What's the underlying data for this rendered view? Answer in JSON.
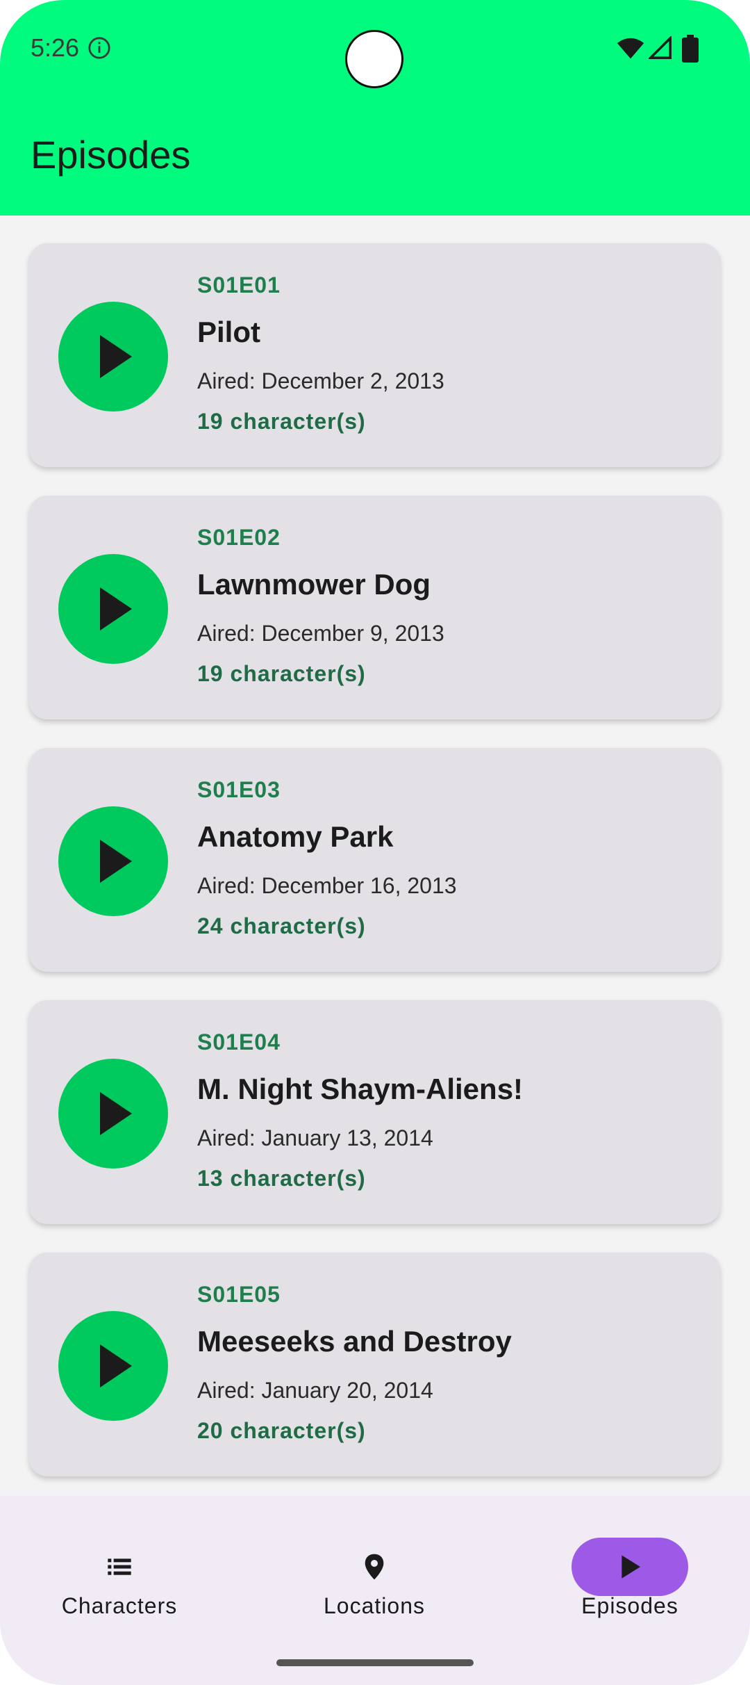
{
  "status_bar": {
    "time": "5:26",
    "icons": [
      "info-icon",
      "wifi-icon",
      "signal-icon",
      "battery-icon"
    ]
  },
  "header": {
    "title": "Episodes",
    "color": "#00fb7f"
  },
  "episodes": [
    {
      "code": "S01E01",
      "title": "Pilot",
      "aired": "Aired: December 2, 2013",
      "characters": "19 character(s)"
    },
    {
      "code": "S01E02",
      "title": "Lawnmower Dog",
      "aired": "Aired: December 9, 2013",
      "characters": "19 character(s)"
    },
    {
      "code": "S01E03",
      "title": "Anatomy Park",
      "aired": "Aired: December 16, 2013",
      "characters": "24 character(s)"
    },
    {
      "code": "S01E04",
      "title": "M. Night Shaym-Aliens!",
      "aired": "Aired: January 13, 2014",
      "characters": "13 character(s)"
    },
    {
      "code": "S01E05",
      "title": "Meeseeks and Destroy",
      "aired": "Aired: January 20, 2014",
      "characters": "20 character(s)"
    }
  ],
  "bottom_nav": {
    "items": [
      {
        "label": "Characters",
        "icon": "list-icon",
        "active": false
      },
      {
        "label": "Locations",
        "icon": "location-pin-icon",
        "active": false
      },
      {
        "label": "Episodes",
        "icon": "play-icon",
        "active": true
      }
    ],
    "active_color": "#9c5ae6"
  },
  "colors": {
    "play_button": "#00c95d",
    "card": "#e3e0e6",
    "accent_text": "#1e7f4d"
  }
}
